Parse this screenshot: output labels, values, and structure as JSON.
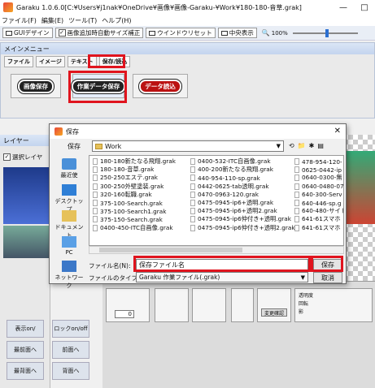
{
  "window": {
    "title": "Garaku 1.0.6.0[C:¥Users¥j1nak¥OneDrive¥画像¥画像-Garaku-¥Work¥180-180-音草.grak]",
    "controls": [
      "—",
      "□"
    ]
  },
  "menubar": [
    "ファイル(F)",
    "編集(E)",
    "ツール(T)",
    "ヘルプ(H)"
  ],
  "toolbar": {
    "gui_design": "GUIデザイン",
    "auto_resize": "画像追加時自動サイズ補正",
    "auto_resize_checked": "✓",
    "window_reset": "ウインドウリセット",
    "center_display": "中央表示",
    "zoom": "100%"
  },
  "main_menu": {
    "title": "メインメニュー",
    "tabs": [
      "ファイル",
      "イメージ",
      "テキスト",
      "保存/読込"
    ],
    "buttons": [
      "画像保存",
      "作業データ保存",
      "データ読込"
    ]
  },
  "layer_panel": {
    "title": "レイヤー",
    "select_layer": "選択レイヤ",
    "buttons": [
      "表示on/",
      "ロックon/off",
      "最前面へ",
      "前面へ",
      "最背面へ",
      "背面へ"
    ]
  },
  "dialog": {
    "title": "保存",
    "location_label": "保存",
    "location_value": "Work",
    "places": [
      "最近使",
      "デスクトップ",
      "ドキュメント",
      "PC",
      "ネットワーク"
    ],
    "files": [
      [
        "180-180新たなる飛翔.grak",
        "180-180-音草.grak",
        "250-250エステ.grak",
        "300-250外壁塗装.grak",
        "320-160転職.grak",
        "375-100-Search.grak",
        "375-100-Search1.grak",
        "375-150-Search.grak",
        "0400-450-ITC自画像.grak"
      ],
      [
        "0400-532-ITC自画像.grak",
        "400-200新たなる飛翔.grak",
        "440-954-110-sp.grak",
        "0442-0625-tab透明.grak",
        "0470-0963-120.grak",
        "0475-0945-ip6+透明.grak",
        "0475-0945-ip6+透明2.grak",
        "0475-0945-ip6仲付き+透明.grak",
        "0475-0945-ip6仲付き+透明2.grak"
      ],
      [
        "478-954-120-",
        "0625-0442-ip",
        "0640-0300-無",
        "0640-0480-07",
        "640-300-Serv",
        "640-446-sp.g",
        "640-480-サイト",
        "641-61スマホ",
        "641-61スマホ"
      ]
    ],
    "filename_label": "ファイル名(N):",
    "filename_value": "保存ファイル名",
    "filetype_label": "ファイルのタイプ(T):",
    "filetype_value": "Garaku 作業ファイル(.grak)",
    "save_button": "保存",
    "cancel_button": "取消"
  },
  "props": {
    "spinner_value": "0",
    "field_labels": [
      "透明度",
      "回転",
      "影"
    ],
    "field_value": "0",
    "convert_button": "変更確認"
  }
}
